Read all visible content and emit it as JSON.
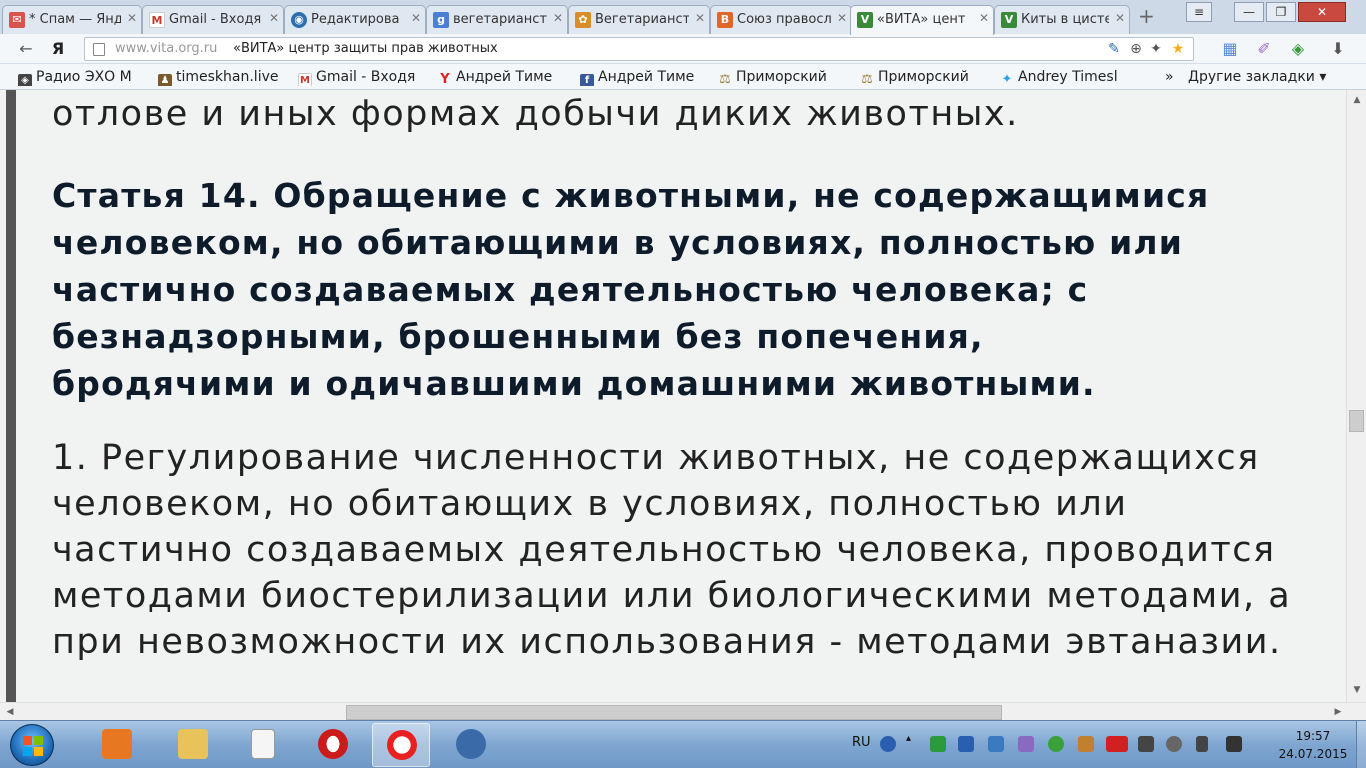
{
  "tabs": [
    {
      "label": "* Спам — Янд",
      "icon": "mail-icon",
      "color": "#d9534f"
    },
    {
      "label": "Gmail - Входя",
      "icon": "gmail-icon",
      "color": "#c43c2f"
    },
    {
      "label": "Редактирова",
      "icon": "globe-icon",
      "color": "#2a6fb0"
    },
    {
      "label": "вегетарианст",
      "icon": "google-icon",
      "color": "#4a7fd6"
    },
    {
      "label": "Вегетарианст",
      "icon": "gear-site-icon",
      "color": "#d98c28"
    },
    {
      "label": "Союз правосл",
      "icon": "blogger-icon",
      "color": "#e0662a"
    },
    {
      "label": "«ВИТА» цент",
      "icon": "vita-icon",
      "color": "#3a8a3a"
    },
    {
      "label": "Киты в цисте",
      "icon": "vita-icon",
      "color": "#3a8a3a"
    }
  ],
  "window_controls": {
    "minimize": "—",
    "maximize": "❐",
    "close": "✕",
    "menu": "≡"
  },
  "toolbar": {
    "back": "←",
    "yandex": "Я",
    "url": "www.vita.org.ru",
    "page_title": "«ВИТА» центр защиты прав животных"
  },
  "bookmarks": [
    {
      "label": "Радио ЭХО М",
      "icon": "radio-icon",
      "color": "#444"
    },
    {
      "label": "timeskhan.live",
      "icon": "person-icon",
      "color": "#7a5a2a"
    },
    {
      "label": "Gmail - Входя",
      "icon": "gmail-icon",
      "color": "#c43c2f"
    },
    {
      "label": "Андрей Тиме",
      "icon": "yandex-icon",
      "color": "#e02020"
    },
    {
      "label": "Андрей Тиме",
      "icon": "facebook-icon",
      "color": "#3b5998"
    },
    {
      "label": "Приморский",
      "icon": "scales-icon",
      "color": "#9a7a3a"
    },
    {
      "label": "Приморский",
      "icon": "scales-icon",
      "color": "#9a7a3a"
    },
    {
      "label": "Andrey Timesl",
      "icon": "twitter-icon",
      "color": "#2aa3ef"
    },
    {
      "label": "»",
      "icon": "",
      "color": ""
    },
    {
      "label": "Другие закладки ▾",
      "icon": "",
      "color": ""
    }
  ],
  "article": {
    "prev_line": "отлове и иных формах добычи диких животных.",
    "heading_lines": [
      "Статья 14. Обращение с животными, не содержащимися",
      "человеком, но обитающими в условиях, полностью или",
      "частично создаваемых деятельностью человека; с",
      "безнадзорными, брошенными без попечения,",
      "бродячими и одичавшими домашними животными."
    ],
    "paragraph_lines": [
      "1. Регулирование численности животных, не содержащихся",
      "человеком, но обитающих в условиях, полностью или",
      "частично создаваемых деятельностью человека, проводится",
      "методами биостерилизации или биологическими методами, а",
      "при невозможности их использования - методами эвтаназии."
    ]
  },
  "taskbar": {
    "apps": [
      {
        "name": "media-player-icon",
        "color": "#e87722"
      },
      {
        "name": "folder-icon",
        "color": "#e8c35a"
      },
      {
        "name": "document-icon",
        "color": "#f5f5f5"
      },
      {
        "name": "opera-icon",
        "color": "#cc1b1b"
      },
      {
        "name": "yandex-browser-icon",
        "color": "#e82020"
      },
      {
        "name": "phone-app-icon",
        "color": "#3a6aa8"
      }
    ],
    "language": "RU",
    "clock_time": "19:57",
    "clock_date": "24.07.2015"
  },
  "colors": {
    "heading": "#0e1b2b",
    "body_text": "#222222",
    "page_bg": "#f0f3f2"
  }
}
